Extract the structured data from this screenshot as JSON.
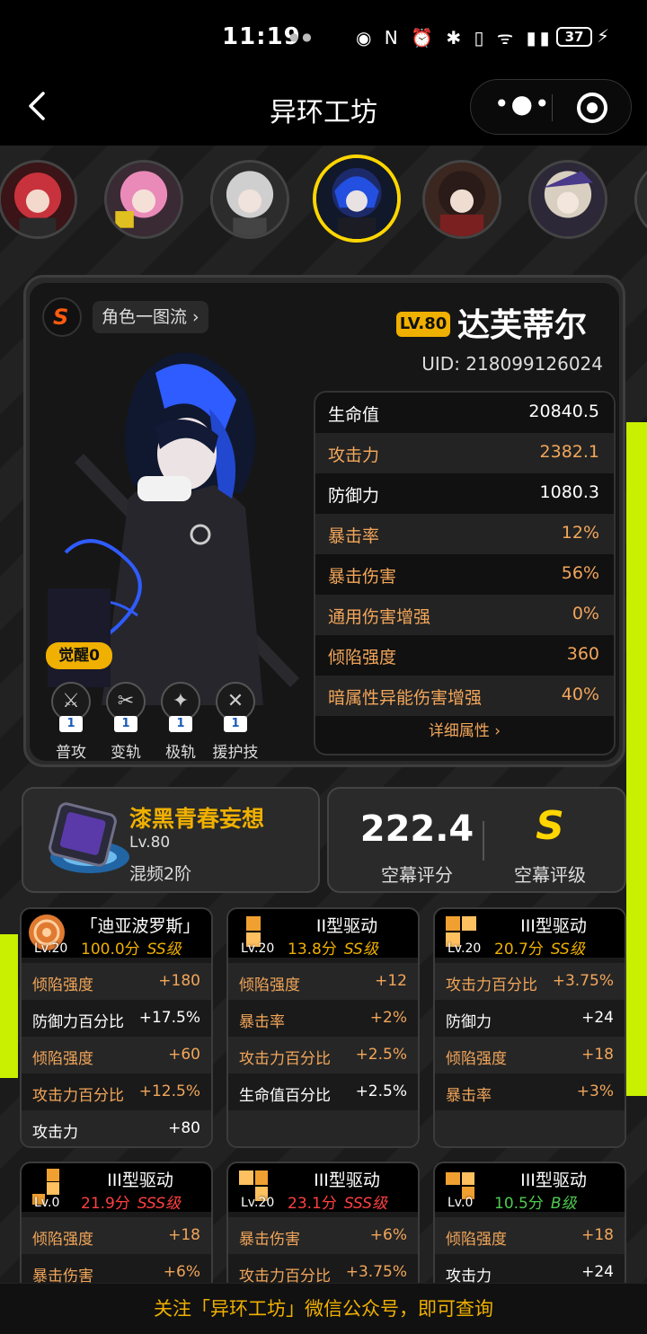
{
  "status": {
    "time": "11:19",
    "battery": "37"
  },
  "nav": {
    "title": "异环工坊"
  },
  "colors": {
    "accent": "#f0b000",
    "highlight": "#f2a65a",
    "lime": "#c8f000",
    "red_rank": "#ff4040",
    "green_rank": "#4ecb4e"
  },
  "character": {
    "gallery_label": "角色一图流 ›",
    "level": "LV.80",
    "name": "达芙蒂尔",
    "uid": "UID: 218099126024",
    "awaken": "觉醒0",
    "stats": [
      {
        "label": "生命值",
        "value": "20840.5",
        "highlight": false
      },
      {
        "label": "攻击力",
        "value": "2382.1",
        "highlight": true
      },
      {
        "label": "防御力",
        "value": "1080.3",
        "highlight": false
      },
      {
        "label": "暴击率",
        "value": "12%",
        "highlight": true
      },
      {
        "label": "暴击伤害",
        "value": "56%",
        "highlight": true
      },
      {
        "label": "通用伤害增强",
        "value": "0%",
        "highlight": true
      },
      {
        "label": "倾陷强度",
        "value": "360",
        "highlight": true
      },
      {
        "label": "暗属性异能伤害增强",
        "value": "40%",
        "highlight": true
      }
    ],
    "detail_link": "详细属性 ›",
    "skills": [
      {
        "label": "普攻",
        "level": "1",
        "icon": "basic-attack-icon"
      },
      {
        "label": "变轨",
        "level": "1",
        "icon": "shift-icon"
      },
      {
        "label": "极轨",
        "level": "1",
        "icon": "ultimate-icon"
      },
      {
        "label": "援护技",
        "level": "1",
        "icon": "support-icon"
      }
    ]
  },
  "weapon": {
    "name": "漆黑青春妄想",
    "level": "Lv.80",
    "phase": "混频2阶"
  },
  "score": {
    "value": "222.4",
    "value_label": "空幕评分",
    "grade": "S",
    "grade_label": "空幕评级"
  },
  "discs": [
    {
      "name": "「迪亚波罗斯」",
      "level": "Lv.20",
      "score": "100.0分",
      "rank": "SS级",
      "rank_color": "gold",
      "subs": [
        {
          "k": "倾陷强度",
          "v": "+180",
          "hl": true
        },
        {
          "k": "防御力百分比",
          "v": "+17.5%",
          "hl": false
        },
        {
          "k": "倾陷强度",
          "v": "+60",
          "hl": true
        },
        {
          "k": "攻击力百分比",
          "v": "+12.5%",
          "hl": true
        },
        {
          "k": "攻击力",
          "v": "+80",
          "hl": false
        }
      ]
    },
    {
      "name": "II型驱动",
      "level": "Lv.20",
      "score": "13.8分",
      "rank": "SS级",
      "rank_color": "gold",
      "subs": [
        {
          "k": "倾陷强度",
          "v": "+12",
          "hl": true
        },
        {
          "k": "暴击率",
          "v": "+2%",
          "hl": true
        },
        {
          "k": "攻击力百分比",
          "v": "+2.5%",
          "hl": true
        },
        {
          "k": "生命值百分比",
          "v": "+2.5%",
          "hl": false
        }
      ]
    },
    {
      "name": "III型驱动",
      "level": "Lv.20",
      "score": "20.7分",
      "rank": "SS级",
      "rank_color": "gold",
      "subs": [
        {
          "k": "攻击力百分比",
          "v": "+3.75%",
          "hl": true
        },
        {
          "k": "防御力",
          "v": "+24",
          "hl": false
        },
        {
          "k": "倾陷强度",
          "v": "+18",
          "hl": true
        },
        {
          "k": "暴击率",
          "v": "+3%",
          "hl": true
        }
      ]
    },
    {
      "name": "III型驱动",
      "level": "Lv.0",
      "score": "21.9分",
      "rank": "SSS级",
      "rank_color": "red",
      "subs": [
        {
          "k": "倾陷强度",
          "v": "+18",
          "hl": true
        },
        {
          "k": "暴击伤害",
          "v": "+6%",
          "hl": true
        }
      ]
    },
    {
      "name": "III型驱动",
      "level": "Lv.20",
      "score": "23.1分",
      "rank": "SSS级",
      "rank_color": "red",
      "subs": [
        {
          "k": "暴击伤害",
          "v": "+6%",
          "hl": true
        },
        {
          "k": "攻击力百分比",
          "v": "+3.75%",
          "hl": true
        }
      ]
    },
    {
      "name": "III型驱动",
      "level": "Lv.0",
      "score": "10.5分",
      "rank": "B级",
      "rank_color": "green",
      "subs": [
        {
          "k": "倾陷强度",
          "v": "+18",
          "hl": true
        },
        {
          "k": "攻击力",
          "v": "+24",
          "hl": false
        }
      ]
    }
  ],
  "footer": {
    "text": "关注「异环工坊」微信公众号，即可查询"
  }
}
